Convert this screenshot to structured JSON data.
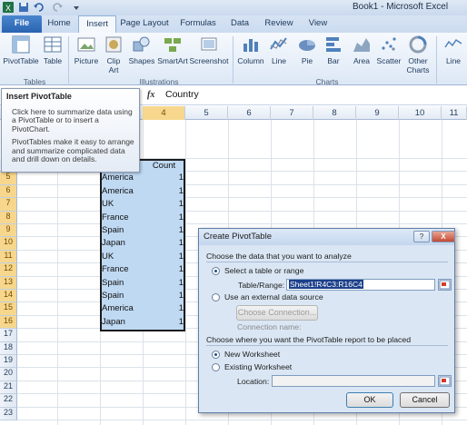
{
  "window": {
    "title": "Book1 - Microsoft Excel"
  },
  "tabs": [
    "File",
    "Home",
    "Insert",
    "Page Layout",
    "Formulas",
    "Data",
    "Review",
    "View"
  ],
  "ribbon": {
    "buttons": {
      "pivottable": "PivotTable",
      "table": "Table",
      "picture": "Picture",
      "clipart": "Clip Art",
      "shapes": "Shapes",
      "smartart": "SmartArt",
      "screenshot": "Screenshot",
      "column": "Column",
      "line": "Line",
      "pie": "Pie",
      "bar": "Bar",
      "area": "Area",
      "scatter": "Scatter",
      "other": "Other Charts",
      "sparkline": "Line"
    },
    "groups": {
      "tables": "Tables",
      "illustrations": "Illustrations",
      "charts": "Charts"
    }
  },
  "formula_bar": {
    "fx": "fx",
    "value": "Country"
  },
  "grid": {
    "columns": [
      "4",
      "5",
      "6",
      "7",
      "8",
      "9",
      "10",
      "11"
    ],
    "rows": [
      "4",
      "5",
      "6",
      "7",
      "8",
      "9",
      "10",
      "11",
      "12",
      "13",
      "14",
      "15",
      "16",
      "17",
      "18",
      "19",
      "20",
      "21",
      "22",
      "23"
    ],
    "header_value": "Count",
    "data": [
      {
        "country": "America",
        "count": "1"
      },
      {
        "country": "America",
        "count": "1"
      },
      {
        "country": "UK",
        "count": "1"
      },
      {
        "country": "France",
        "count": "1"
      },
      {
        "country": "Spain",
        "count": "1"
      },
      {
        "country": "Japan",
        "count": "1"
      },
      {
        "country": "UK",
        "count": "1"
      },
      {
        "country": "France",
        "count": "1"
      },
      {
        "country": "Spain",
        "count": "1"
      },
      {
        "country": "Spain",
        "count": "1"
      },
      {
        "country": "America",
        "count": "1"
      },
      {
        "country": "Japan",
        "count": "1"
      }
    ]
  },
  "tooltip": {
    "title": "Insert PivotTable",
    "p1": "Click here to summarize data using a PivotTable or to insert a PivotChart.",
    "p2": "PivotTables make it easy to arrange and summarize complicated data and drill down on details."
  },
  "dialog": {
    "title": "Create PivotTable",
    "help": "?",
    "close": "X",
    "section1": "Choose the data that you want to analyze",
    "select_range": "Select a table or range",
    "table_range_label": "Table/Range:",
    "table_range_value": "Sheet1!R4C3:R16C4",
    "external": "Use an external data source",
    "choose_connection": "Choose Connection...",
    "connection_name": "Connection name:",
    "section2": "Choose where you want the PivotTable report to be placed",
    "new_ws": "New Worksheet",
    "existing_ws": "Existing Worksheet",
    "location_label": "Location:",
    "location_value": "",
    "ok": "OK",
    "cancel": "Cancel"
  }
}
